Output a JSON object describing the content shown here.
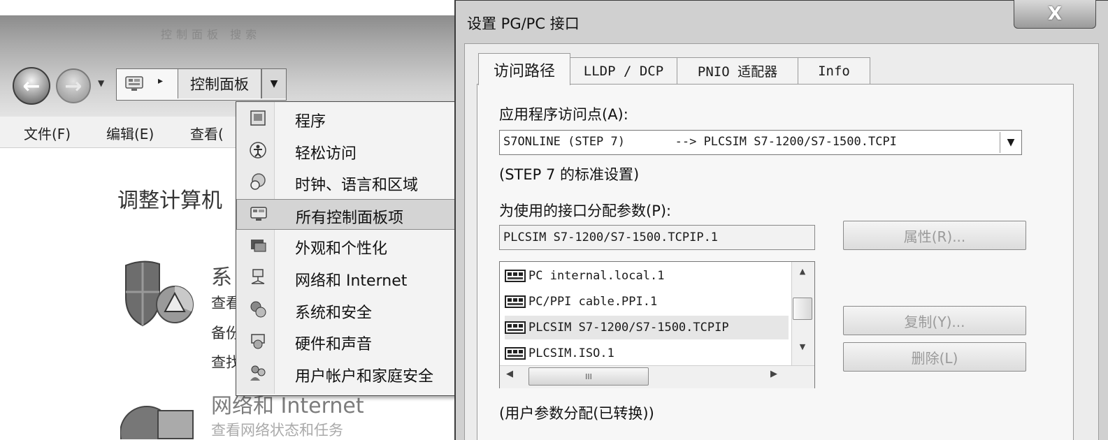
{
  "explorer": {
    "title_faded": "控制面板 搜索",
    "address": {
      "crumb": "控制面板",
      "arrow": "▸"
    },
    "menu": [
      "文件(F)",
      "编辑(E)",
      "查看("
    ],
    "heading": "调整计算机",
    "categories": [
      {
        "title": "系",
        "lines": [
          "查看",
          "备份",
          "查找"
        ]
      },
      {
        "title": "网络和 Internet",
        "lines": [
          "查看网络状态和任务"
        ]
      }
    ]
  },
  "dropdown": {
    "selected_index": 3,
    "items": [
      {
        "label": "程序",
        "icon": "programs-icon"
      },
      {
        "label": "轻松访问",
        "icon": "ease-of-access-icon"
      },
      {
        "label": "时钟、语言和区域",
        "icon": "clock-language-icon"
      },
      {
        "label": "所有控制面板项",
        "icon": "all-control-panel-icon"
      },
      {
        "label": "外观和个性化",
        "icon": "appearance-icon"
      },
      {
        "label": "网络和 Internet",
        "icon": "network-icon"
      },
      {
        "label": "系统和安全",
        "icon": "system-security-icon"
      },
      {
        "label": "硬件和声音",
        "icon": "hardware-sound-icon"
      },
      {
        "label": "用户帐户和家庭安全",
        "icon": "user-accounts-icon"
      }
    ]
  },
  "dialog": {
    "title": "设置 PG/PC 接口",
    "close_label": "X",
    "tabs": [
      "访问路径",
      "LLDP / DCP",
      "PNIO 适配器",
      "Info"
    ],
    "access_point_label": "应用程序访问点(A):",
    "access_point_value": "S7ONLINE (STEP 7)       --> PLCSIM S7-1200/S7-1500.TCPI",
    "access_point_note": "(STEP 7 的标准设置)",
    "param_label": "为使用的接口分配参数(P):",
    "param_value": "PLCSIM S7-1200/S7-1500.TCPIP.1",
    "buttons": {
      "properties": "属性(R)...",
      "copy": "复制(Y)...",
      "delete": "删除(L)"
    },
    "interfaces": [
      "PC internal.local.1",
      "PC/PPI cable.PPI.1",
      "PLCSIM S7-1200/S7-1500.TCPIP",
      "PLCSIM.ISO.1"
    ],
    "selected_interface": 2,
    "hscroll_grip": "III",
    "footer_note": "(用户参数分配(已转换))"
  },
  "colors": {
    "selection": "#d4d4d4",
    "dialog_bg": "#ececec",
    "frame": "#a9a9a9"
  }
}
